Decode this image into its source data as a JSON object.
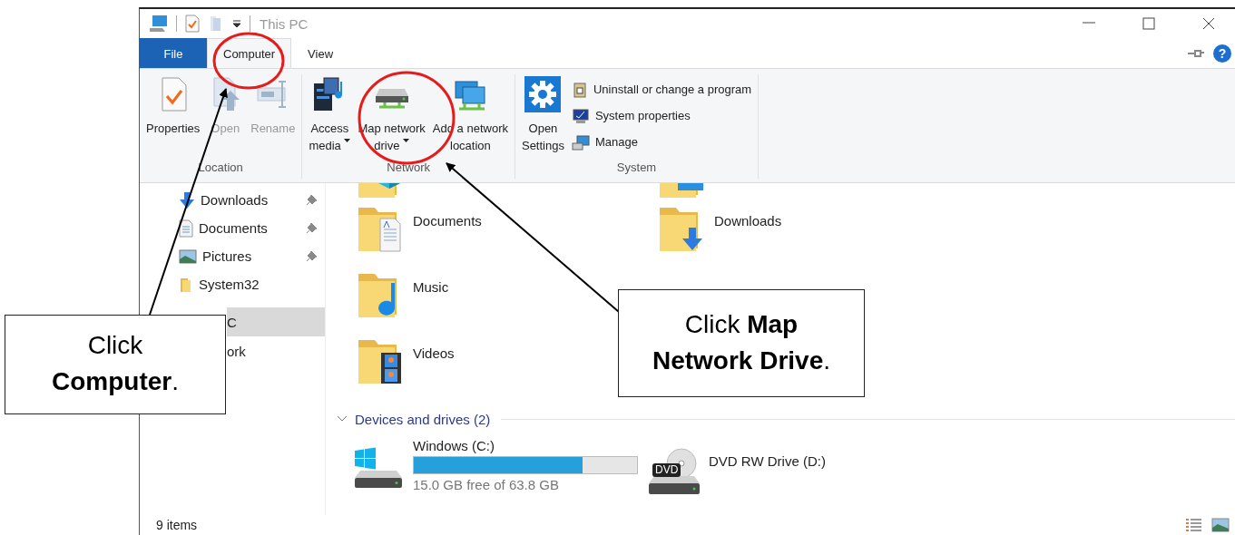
{
  "window": {
    "title": "This PC",
    "help": "?"
  },
  "tabs": [
    {
      "label": "File",
      "kind": "file",
      "selected": false
    },
    {
      "label": "Computer",
      "kind": "tab",
      "selected": true
    },
    {
      "label": "View",
      "kind": "tab",
      "selected": false
    }
  ],
  "ribbon": [
    {
      "label": "Location",
      "buttons": [
        {
          "label": "Properties",
          "kind": "properties",
          "disabled": false,
          "dropdown": false
        },
        {
          "label": "Open",
          "kind": "open",
          "disabled": true,
          "dropdown": false
        },
        {
          "label": "Rename",
          "kind": "rename",
          "disabled": true,
          "dropdown": false
        }
      ]
    },
    {
      "label": "Network",
      "buttons": [
        {
          "label": "Access\nmedia",
          "kind": "media",
          "disabled": false,
          "dropdown": true
        },
        {
          "label": "Map network\ndrive",
          "kind": "netdrive",
          "disabled": false,
          "dropdown": true
        },
        {
          "label": "Add a network\nlocation",
          "kind": "netlocation",
          "disabled": false,
          "dropdown": false
        }
      ]
    },
    {
      "label": "System",
      "buttons": [
        {
          "label": "Open\nSettings",
          "kind": "settings",
          "disabled": false,
          "dropdown": false
        }
      ],
      "small_buttons": [
        {
          "label": "Uninstall or change a program",
          "kind": "uninstall"
        },
        {
          "label": "System properties",
          "kind": "sysprops"
        },
        {
          "label": "Manage",
          "kind": "manage"
        }
      ]
    }
  ],
  "nav": [
    {
      "label": "Downloads",
      "kind": "downloads",
      "pinned": true,
      "selected": false
    },
    {
      "label": "Documents",
      "kind": "documents",
      "pinned": true,
      "selected": false
    },
    {
      "label": "Pictures",
      "kind": "pictures",
      "pinned": true,
      "selected": false
    },
    {
      "label": "System32",
      "kind": "folder",
      "pinned": false,
      "selected": false
    },
    {
      "label": "C",
      "kind": "covered",
      "pinned": false,
      "selected": true
    },
    {
      "label": "ork",
      "kind": "covered",
      "pinned": false,
      "selected": false
    }
  ],
  "scrolled_folders": [
    {
      "kind": "cube"
    },
    {
      "kind": "screen"
    }
  ],
  "folder_rows": [
    [
      {
        "label": "Documents",
        "kind": "documents"
      },
      {
        "label": "Downloads",
        "kind": "downloads"
      }
    ],
    [
      {
        "label": "Music",
        "kind": "music"
      }
    ],
    [
      {
        "label": "Videos",
        "kind": "videos"
      }
    ]
  ],
  "devices": {
    "header": "Devices and drives (2)",
    "expanded": true,
    "drives": [
      {
        "label": "Windows (C:)",
        "kind": "windows",
        "level": 0.755,
        "free": "15.0 GB free of 63.8 GB"
      },
      {
        "label": "DVD RW Drive (D:)",
        "kind": "dvd",
        "badge": "DVD"
      }
    ]
  },
  "status_bar": {
    "items": "9 items"
  },
  "callouts": [
    {
      "text": "Click\n**Computer**."
    },
    {
      "text": "Click **Map**\n**Network Drive**."
    }
  ]
}
